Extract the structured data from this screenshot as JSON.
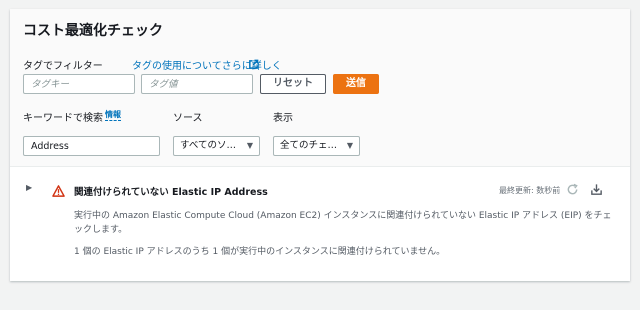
{
  "panel": {
    "title": "コスト最適化チェック",
    "filter_label": "タグでフィルター",
    "filter_link": "タグの使用についてさらに詳しく",
    "tag_key_placeholder": "タグキー",
    "tag_value_placeholder": "タグ値",
    "reset_label": "リセット",
    "send_label": "送信",
    "keyword_label": "キーワードで検索",
    "info_label": "情報",
    "source_label": "ソース",
    "display_label": "表示",
    "keyword_value": "Address",
    "source_select_value": "すべてのソ…",
    "display_select_value": "全てのチェ…"
  },
  "check": {
    "title": "関連付けられていない Elastic IP Address",
    "last_updated": "最終更新: 数秒前",
    "description": "実行中の Amazon Elastic Compute Cloud (Amazon EC2) インスタンスに関連付けられていない Elastic IP アドレス (EIP) をチェックします。",
    "summary": "1 個の Elastic IP アドレスのうち 1 個が実行中のインスタンスに関連付けられていません。"
  },
  "icons": {
    "external_link": "external-link-icon",
    "warning": "warning-icon",
    "refresh": "refresh-icon",
    "download": "download-icon",
    "expand": "caret-right-icon",
    "select_caret": "caret-down-icon"
  },
  "colors": {
    "link": "#0073bb",
    "primary_button": "#ec7211",
    "warning": "#d13212"
  }
}
